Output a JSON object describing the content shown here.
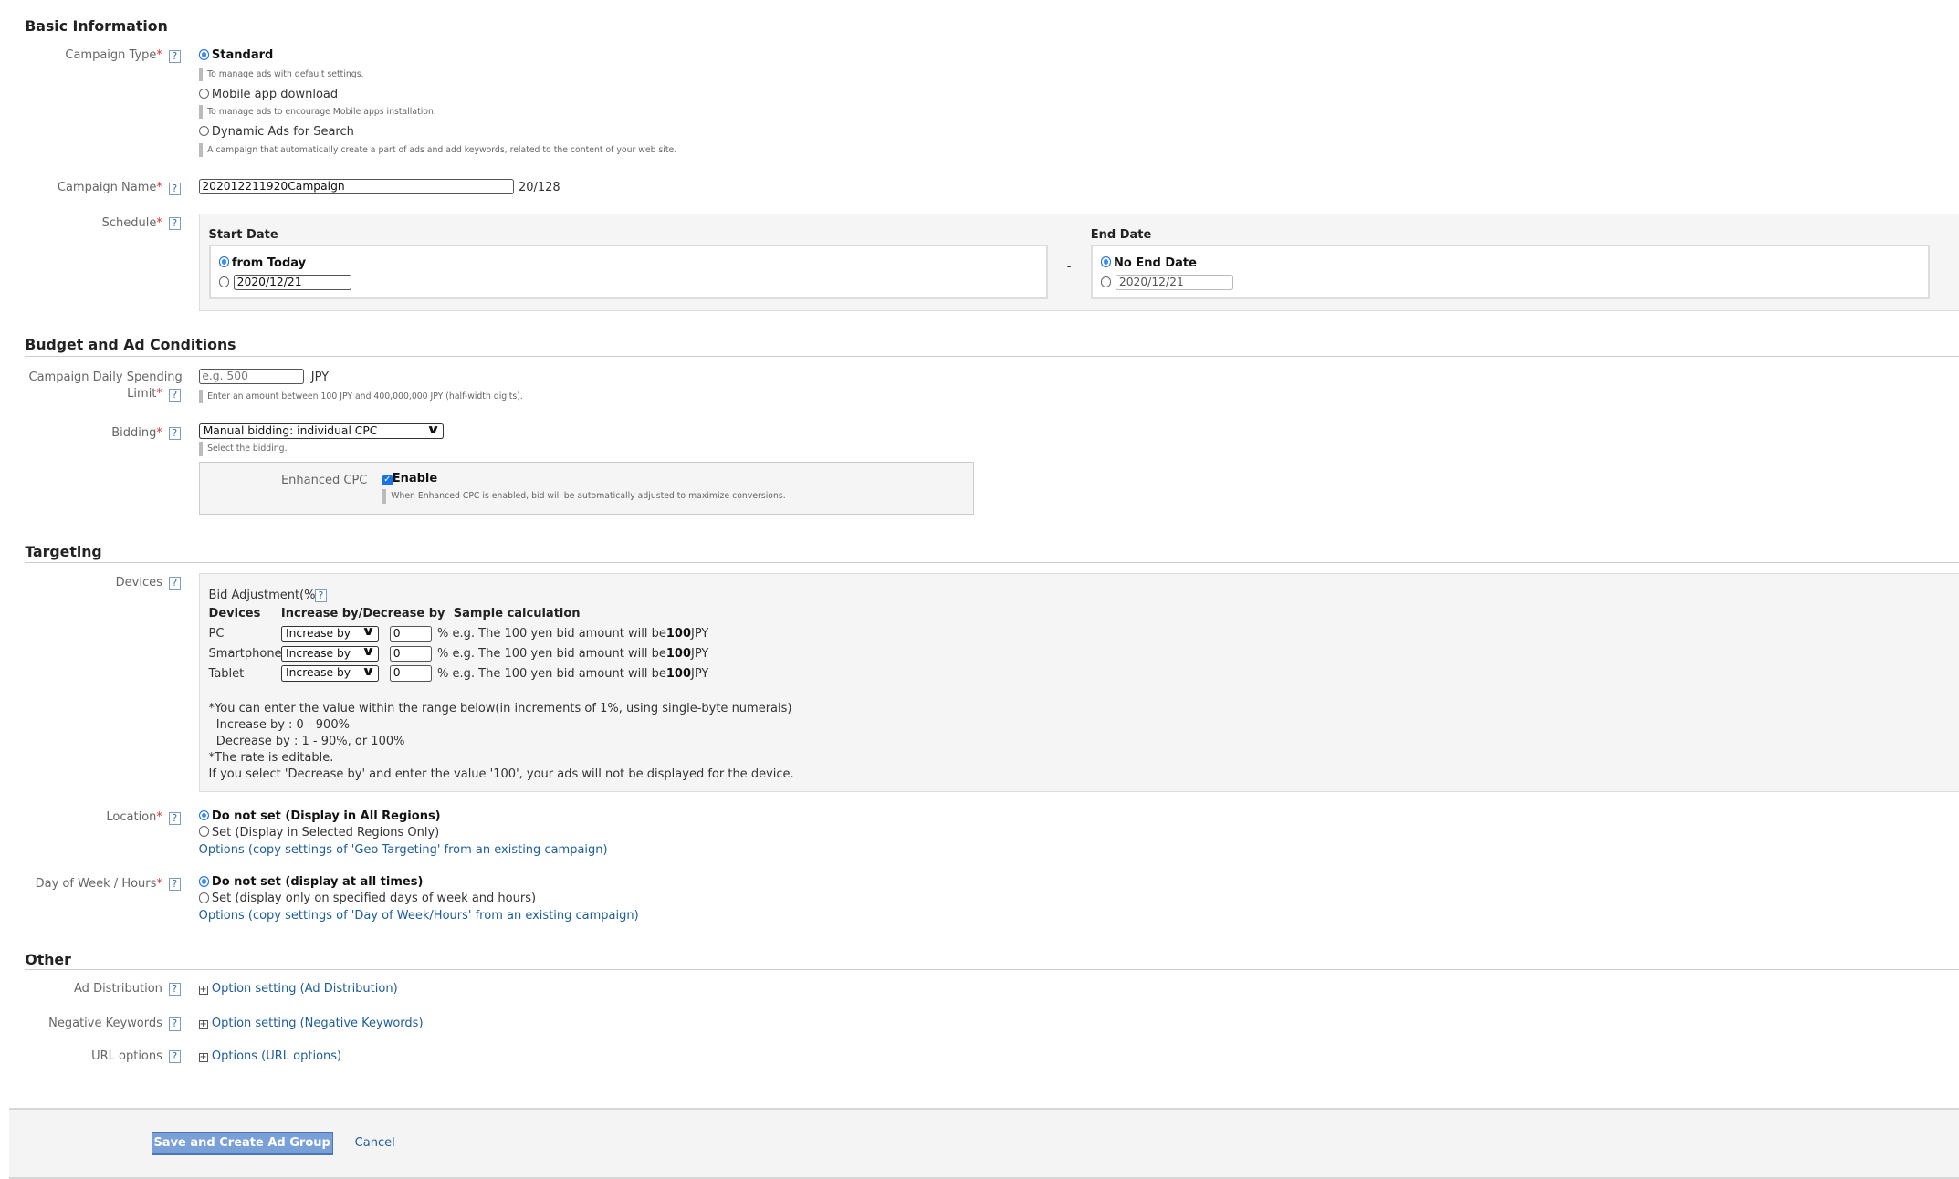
{
  "basic": {
    "heading": "Basic Information",
    "campaign_type": {
      "label": "Campaign Type",
      "options": [
        {
          "label": "Standard",
          "help": "To manage ads with default settings.",
          "selected": true
        },
        {
          "label": "Mobile app download",
          "help": "To manage ads to encourage Mobile apps installation.",
          "selected": false
        },
        {
          "label": "Dynamic Ads for Search",
          "help": "A campaign that automatically create a part of ads and add keywords, related to the content of your web site.",
          "selected": false
        }
      ]
    },
    "campaign_name": {
      "label": "Campaign Name",
      "value": "202012211920Campaign",
      "counter": "20/128"
    },
    "schedule": {
      "label": "Schedule",
      "start_title": "Start Date",
      "from_today": "from Today",
      "start_date": "2020/12/21",
      "separator": "-",
      "end_title": "End Date",
      "no_end": "No End Date",
      "end_date": "2020/12/21"
    }
  },
  "budget": {
    "heading": "Budget and Ad Conditions",
    "limit": {
      "label_line1": "Campaign Daily Spending",
      "label_line2": "Limit",
      "placeholder": "e.g. 500",
      "unit": "JPY",
      "help": "Enter an amount between 100 JPY and 400,000,000 JPY (half-width digits)."
    },
    "bidding": {
      "label": "Bidding",
      "value": "Manual bidding: individual CPC",
      "help": "Select the bidding.",
      "ecpc_label": "Enhanced CPC",
      "ecpc_checkbox": "Enable",
      "ecpc_checked": true,
      "ecpc_help": "When Enhanced CPC is enabled, bid will be automatically adjusted to maximize conversions."
    }
  },
  "targeting": {
    "heading": "Targeting",
    "devices": {
      "label": "Devices",
      "bid_title": "Bid Adjustment(%)",
      "col_devices": "Devices",
      "col_adj": "Increase by/Decrease by",
      "col_sample": "Sample calculation",
      "rows": [
        {
          "device": "PC",
          "mode": "Increase by",
          "value": "0"
        },
        {
          "device": "Smartphone",
          "mode": "Increase by",
          "value": "0"
        },
        {
          "device": "Tablet",
          "mode": "Increase by",
          "value": "0"
        }
      ],
      "pct": "%",
      "sample_prefix": "e.g. The 100 yen bid amount will be",
      "sample_value": "100",
      "sample_unit": "JPY",
      "notes": [
        "*You can enter the value within the range below(in increments of 1%, using single-byte numerals)",
        "  Increase by : 0 - 900%",
        "  Decrease by : 1 - 90%, or 100%",
        "*The rate is editable.",
        "If you select 'Decrease by' and enter the value '100', your ads will not be displayed for the device."
      ]
    },
    "location": {
      "label": "Location",
      "opt1": "Do not set (Display in All Regions)",
      "opt2": "Set (Display in Selected Regions Only)",
      "link": "Options (copy settings of 'Geo Targeting' from an existing campaign)"
    },
    "dow": {
      "label": "Day of Week / Hours",
      "opt1": "Do not set (display at all times)",
      "opt2": "Set (display only on specified days of week and hours)",
      "link": "Options (copy settings of 'Day of Week/Hours' from an existing campaign)"
    }
  },
  "other": {
    "heading": "Other",
    "ad_dist": {
      "label": "Ad Distribution",
      "link": "Option setting (Ad Distribution)"
    },
    "neg_kw": {
      "label": "Negative Keywords",
      "link": "Option setting (Negative Keywords)"
    },
    "url": {
      "label": "URL options",
      "link": "Options (URL options)"
    }
  },
  "footer": {
    "save": "Save and Create Ad Group",
    "cancel": "Cancel"
  },
  "common": {
    "required": "*",
    "help_icon": "?"
  },
  "colors": {
    "accent": "#1a73e8",
    "link": "#1d5d9a",
    "button": "#7aa0d8"
  }
}
